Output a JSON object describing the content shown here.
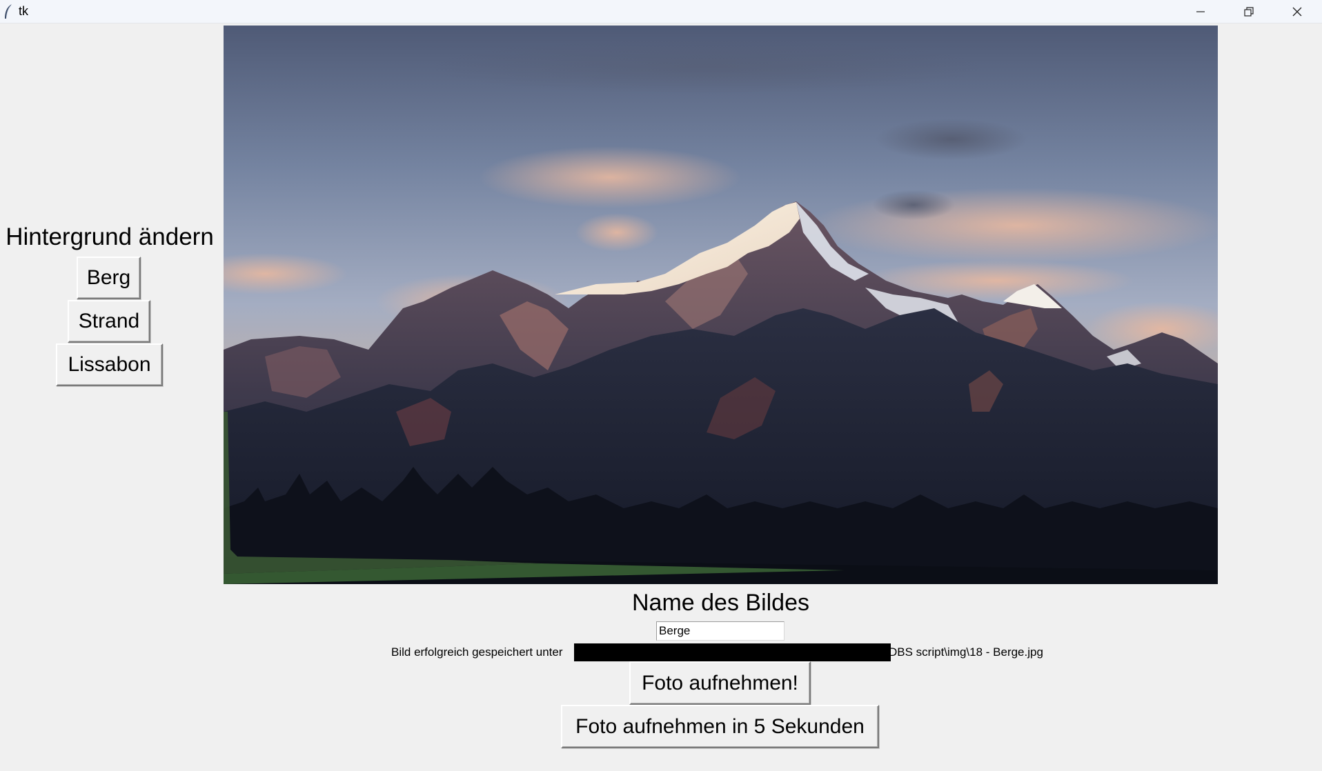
{
  "window": {
    "title": "tk",
    "controls": {
      "minimize_icon": "minimize-icon",
      "maximize_icon": "restore-icon",
      "close_icon": "close-icon"
    }
  },
  "left_panel": {
    "heading": "Hintergrund ändern",
    "buttons": [
      {
        "label": "Berg"
      },
      {
        "label": "Strand"
      },
      {
        "label": "Lissabon"
      }
    ]
  },
  "main": {
    "image": {
      "subject": "mountain landscape at dusk",
      "sky_top": "#5e6b86",
      "sky_mid": "#9aa6bd",
      "mountain_dark": "#1d2436",
      "snow": "#f4ece2"
    },
    "name_label": "Name des Bildes",
    "name_input_value": "Berge",
    "status": {
      "prefix": "Bild erfolgreich gespeichert unter",
      "suffix": "DBS script\\img\\18 - Berge.jpg"
    },
    "capture_button": "Foto aufnehmen!",
    "capture_delay_button": "Foto aufnehmen in 5 Sekunden"
  }
}
